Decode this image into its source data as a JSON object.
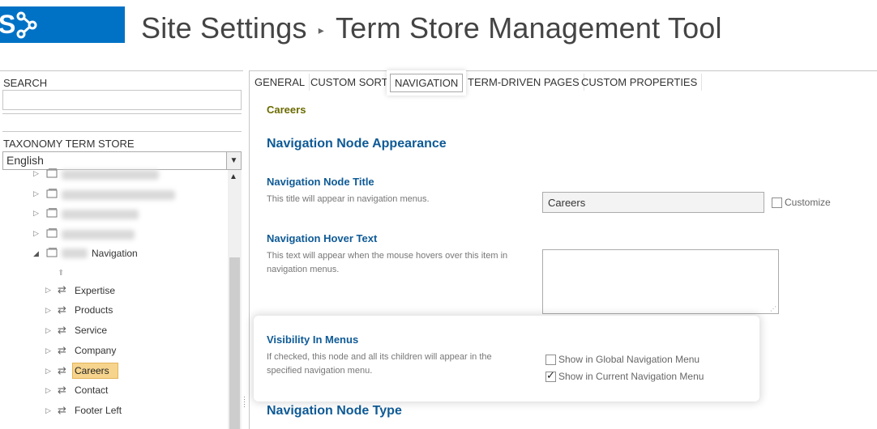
{
  "header": {
    "logo_letter": "S",
    "title_part1": "Site Settings",
    "separator": "▸",
    "title_part2": "Term Store Management Tool"
  },
  "left": {
    "search_label": "SEARCH",
    "search_value": "",
    "taxonomy_label": "TAXONOMY TERM STORE",
    "language": "English",
    "tree": {
      "navigation_group": "Navigation",
      "items": [
        {
          "label": "Expertise"
        },
        {
          "label": "Products"
        },
        {
          "label": "Service"
        },
        {
          "label": "Company"
        },
        {
          "label": "Careers"
        },
        {
          "label": "Contact"
        },
        {
          "label": "Footer Left"
        }
      ]
    }
  },
  "tabs": [
    {
      "label": "GENERAL"
    },
    {
      "label": "CUSTOM SORT"
    },
    {
      "label": "NAVIGATION"
    },
    {
      "label": "TERM-DRIVEN PAGES"
    },
    {
      "label": "CUSTOM PROPERTIES"
    }
  ],
  "main": {
    "term_name": "Careers",
    "appearance_heading": "Navigation Node Appearance",
    "node_title_label": "Navigation Node Title",
    "node_title_desc": "This title will appear in navigation menus.",
    "node_title_value": "Careers",
    "customize_label": "Customize",
    "hover_label": "Navigation Hover Text",
    "hover_desc": "This text will appear when the mouse hovers over this item in navigation menus.",
    "visibility_label": "Visibility In Menus",
    "visibility_desc": "If checked, this node and all its children will appear in the specified navigation menu.",
    "global_nav_label": "Show in Global Navigation Menu",
    "current_nav_label": "Show in Current Navigation Menu",
    "node_type_heading": "Navigation Node Type"
  },
  "colors": {
    "brand": "#0072c6",
    "heading": "#0e5a96",
    "term": "#6b6b00",
    "selection": "#f6d48d"
  }
}
